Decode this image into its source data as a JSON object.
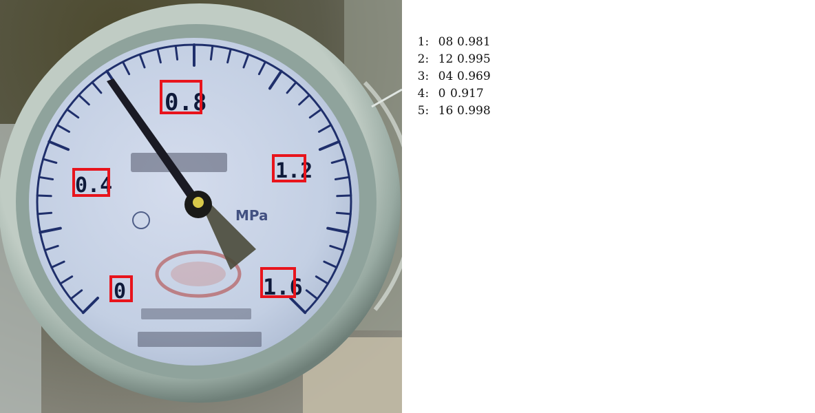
{
  "results_panel": {
    "rows": [
      {
        "index": "1:",
        "text": "08",
        "score": "0.981"
      },
      {
        "index": "2:",
        "text": "12",
        "score": "0.995"
      },
      {
        "index": "3:",
        "text": "04",
        "score": "0.969"
      },
      {
        "index": "4:",
        "text": "0",
        "score": "0.917"
      },
      {
        "index": "5:",
        "text": "16",
        "score": "0.998"
      }
    ]
  },
  "photo": {
    "dial_labels": [
      "0.8",
      "1.2",
      "0.4",
      "0",
      "1.6"
    ],
    "unit": "MPa",
    "detection_box_color": "#e8141c"
  },
  "colors": {
    "dial_face": "#c8d4e6",
    "dial_rim": "#9fb0a8",
    "tick_color": "#1f2f6b",
    "needle_color": "#1a1a24"
  }
}
